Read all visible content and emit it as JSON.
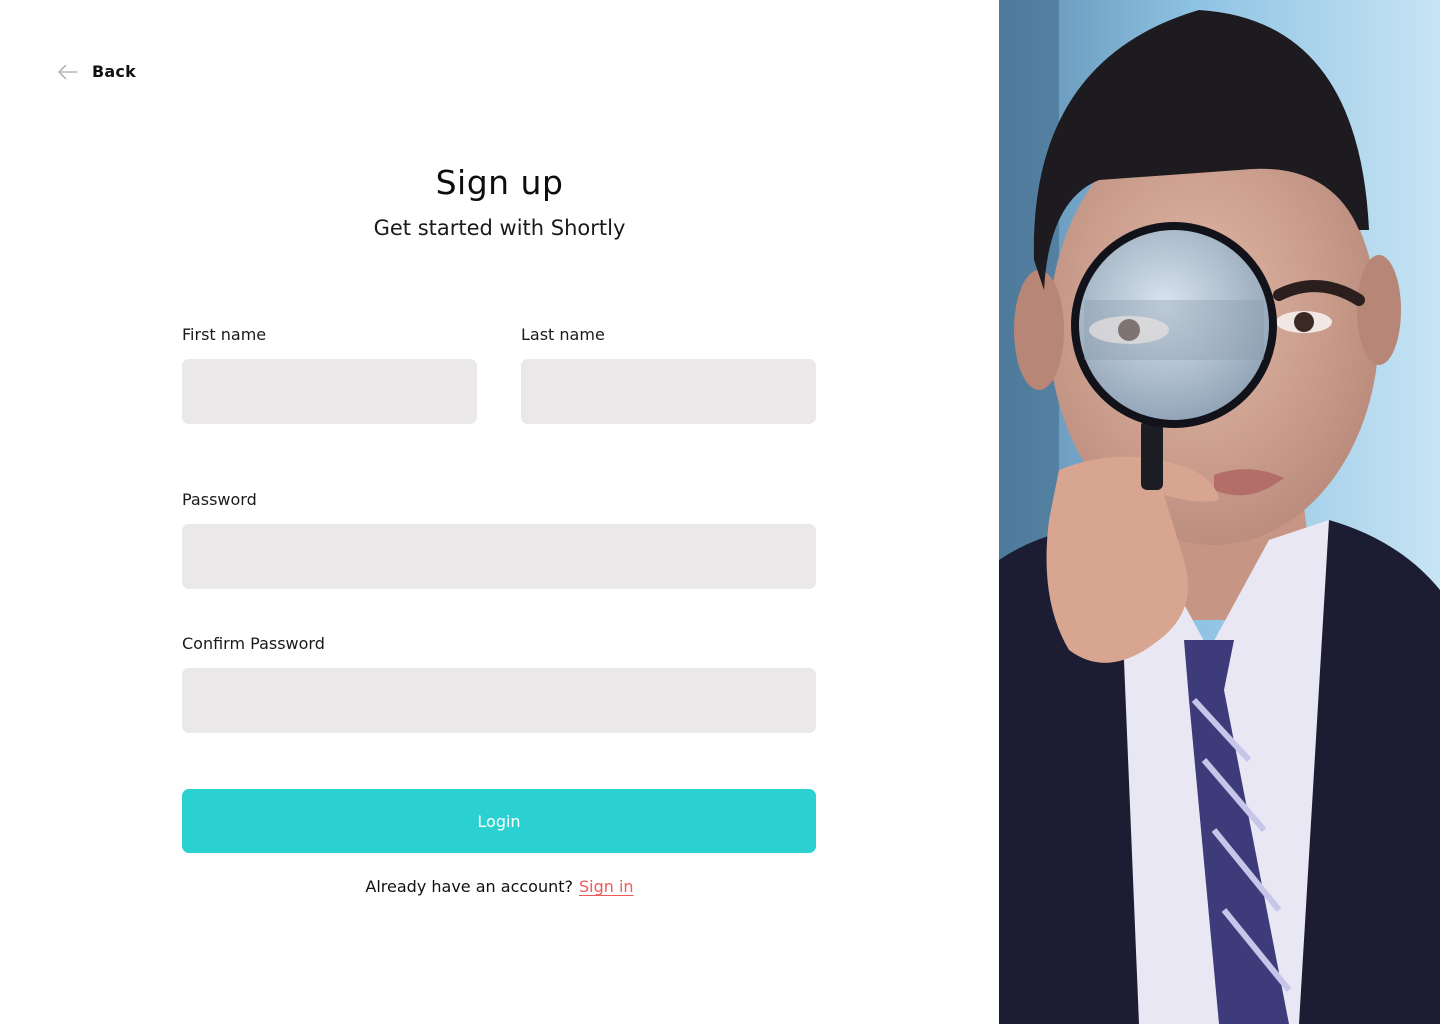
{
  "nav": {
    "back_label": "Back",
    "back_icon": "arrow-left-icon"
  },
  "header": {
    "title": "Sign up",
    "subtitle": "Get started with Shortly"
  },
  "form": {
    "first_name": {
      "label": "First name",
      "value": "",
      "placeholder": ""
    },
    "last_name": {
      "label": "Last name",
      "value": "",
      "placeholder": ""
    },
    "password": {
      "label": "Password",
      "value": "",
      "placeholder": ""
    },
    "confirm_password": {
      "label": "Confirm Password",
      "value": "",
      "placeholder": ""
    },
    "submit_label": "Login"
  },
  "footer": {
    "prompt": "Already have an account?",
    "link_label": "Sign in"
  },
  "colors": {
    "accent": "#2ad1d0",
    "link": "#ef5b5b",
    "input_bg": "#eae8e9"
  }
}
